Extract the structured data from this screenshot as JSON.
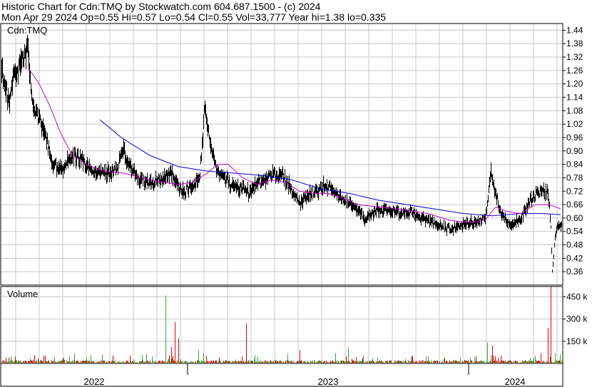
{
  "header": {
    "line1": "Historic Chart for Cdn:TMQ by Stockwatch.com 604.687.1500 - (c) 2024",
    "line2": "Mon Apr 29 2024  Op=0.55  Hi=0.57  Lo=0.54  Cl=0.55  Vol=33,777  Year hi=1.38  lo=0.335"
  },
  "chart_data": [
    {
      "type": "line",
      "panel": "price",
      "title": "Cdn:TMQ",
      "y_ticks": [
        "1.44",
        "1.38",
        "1.32",
        "1.26",
        "1.20",
        "1.14",
        "1.08",
        "1.02",
        "0.96",
        "0.90",
        "0.84",
        "0.78",
        "0.72",
        "0.66",
        "0.60",
        "0.54",
        "0.48",
        "0.42",
        "0.36"
      ],
      "ylim": [
        0.3,
        1.47
      ],
      "x_labels": [
        "2022",
        "2023",
        "2024"
      ],
      "grid": true,
      "series_style": {
        "price_bars": "#000000",
        "ma_short": "#cc00cc",
        "ma_long": "#0000cc"
      },
      "price_anchors": [
        [
          0,
          1.33
        ],
        [
          5,
          1.22
        ],
        [
          12,
          1.12
        ],
        [
          20,
          1.25
        ],
        [
          30,
          1.3
        ],
        [
          38,
          1.37
        ],
        [
          45,
          1.1
        ],
        [
          55,
          1.05
        ],
        [
          62,
          0.98
        ],
        [
          72,
          0.86
        ],
        [
          82,
          0.82
        ],
        [
          92,
          0.84
        ],
        [
          100,
          0.88
        ],
        [
          110,
          0.86
        ],
        [
          125,
          0.82
        ],
        [
          140,
          0.81
        ],
        [
          155,
          0.8
        ],
        [
          165,
          0.82
        ],
        [
          172,
          0.92
        ],
        [
          180,
          0.84
        ],
        [
          195,
          0.77
        ],
        [
          210,
          0.75
        ],
        [
          225,
          0.77
        ],
        [
          240,
          0.8
        ],
        [
          255,
          0.72
        ],
        [
          270,
          0.74
        ],
        [
          280,
          0.8
        ],
        [
          287,
          1.1
        ],
        [
          295,
          0.9
        ],
        [
          305,
          0.8
        ],
        [
          320,
          0.76
        ],
        [
          335,
          0.74
        ],
        [
          350,
          0.71
        ],
        [
          365,
          0.77
        ],
        [
          380,
          0.79
        ],
        [
          395,
          0.8
        ],
        [
          410,
          0.72
        ],
        [
          420,
          0.66
        ],
        [
          430,
          0.7
        ],
        [
          445,
          0.72
        ],
        [
          455,
          0.75
        ],
        [
          465,
          0.73
        ],
        [
          480,
          0.68
        ],
        [
          495,
          0.66
        ],
        [
          510,
          0.6
        ],
        [
          525,
          0.63
        ],
        [
          540,
          0.64
        ],
        [
          560,
          0.62
        ],
        [
          575,
          0.63
        ],
        [
          590,
          0.6
        ],
        [
          605,
          0.58
        ],
        [
          620,
          0.56
        ],
        [
          635,
          0.55
        ],
        [
          650,
          0.57
        ],
        [
          665,
          0.58
        ],
        [
          675,
          0.59
        ],
        [
          682,
          0.62
        ],
        [
          688,
          0.82
        ],
        [
          693,
          0.72
        ],
        [
          700,
          0.64
        ],
        [
          710,
          0.58
        ],
        [
          720,
          0.57
        ],
        [
          730,
          0.6
        ],
        [
          740,
          0.66
        ],
        [
          748,
          0.7
        ],
        [
          758,
          0.72
        ],
        [
          768,
          0.72
        ],
        [
          772,
          0.56
        ],
        [
          774,
          0.36
        ],
        [
          778,
          0.52
        ],
        [
          782,
          0.57
        ],
        [
          787,
          0.56
        ]
      ],
      "ma_short_anchors": [
        [
          40,
          1.27
        ],
        [
          55,
          1.2
        ],
        [
          70,
          1.1
        ],
        [
          85,
          0.98
        ],
        [
          100,
          0.89
        ],
        [
          120,
          0.84
        ],
        [
          145,
          0.81
        ],
        [
          175,
          0.8
        ],
        [
          210,
          0.77
        ],
        [
          250,
          0.75
        ],
        [
          270,
          0.76
        ],
        [
          290,
          0.8
        ],
        [
          305,
          0.84
        ],
        [
          320,
          0.84
        ],
        [
          340,
          0.78
        ],
        [
          360,
          0.75
        ],
        [
          380,
          0.77
        ],
        [
          400,
          0.76
        ],
        [
          420,
          0.72
        ],
        [
          440,
          0.71
        ],
        [
          460,
          0.71
        ],
        [
          480,
          0.69
        ],
        [
          500,
          0.66
        ],
        [
          530,
          0.65
        ],
        [
          560,
          0.64
        ],
        [
          580,
          0.63
        ],
        [
          600,
          0.62
        ],
        [
          630,
          0.59
        ],
        [
          660,
          0.58
        ],
        [
          680,
          0.59
        ],
        [
          695,
          0.65
        ],
        [
          710,
          0.63
        ],
        [
          730,
          0.62
        ],
        [
          750,
          0.66
        ],
        [
          770,
          0.66
        ],
        [
          787,
          0.64
        ]
      ],
      "ma_long_anchors": [
        [
          140,
          1.04
        ],
        [
          170,
          0.96
        ],
        [
          210,
          0.88
        ],
        [
          250,
          0.83
        ],
        [
          290,
          0.81
        ],
        [
          330,
          0.8
        ],
        [
          370,
          0.79
        ],
        [
          410,
          0.77
        ],
        [
          450,
          0.73
        ],
        [
          490,
          0.71
        ],
        [
          530,
          0.68
        ],
        [
          570,
          0.66
        ],
        [
          610,
          0.64
        ],
        [
          650,
          0.62
        ],
        [
          690,
          0.61
        ],
        [
          730,
          0.62
        ],
        [
          760,
          0.62
        ],
        [
          787,
          0.615
        ]
      ]
    },
    {
      "type": "bar",
      "panel": "volume",
      "title": "Volume",
      "y_ticks": [
        "450 k",
        "300 k",
        "150 k"
      ],
      "ylim": [
        0,
        520
      ],
      "up_color": "#33aa33",
      "down_color": "#dd0000",
      "volume_spikes": [
        [
          8,
          40
        ],
        [
          42,
          35
        ],
        [
          104,
          70
        ],
        [
          158,
          55
        ],
        [
          232,
          460
        ],
        [
          240,
          110
        ],
        [
          245,
          280
        ],
        [
          250,
          170
        ],
        [
          278,
          90
        ],
        [
          285,
          70
        ],
        [
          345,
          270
        ],
        [
          420,
          90
        ],
        [
          470,
          70
        ],
        [
          488,
          110
        ],
        [
          600,
          50
        ],
        [
          665,
          40
        ],
        [
          683,
          140
        ],
        [
          690,
          120
        ],
        [
          748,
          40
        ],
        [
          758,
          70
        ],
        [
          768,
          240
        ],
        [
          772,
          520
        ],
        [
          778,
          70
        ]
      ]
    }
  ]
}
